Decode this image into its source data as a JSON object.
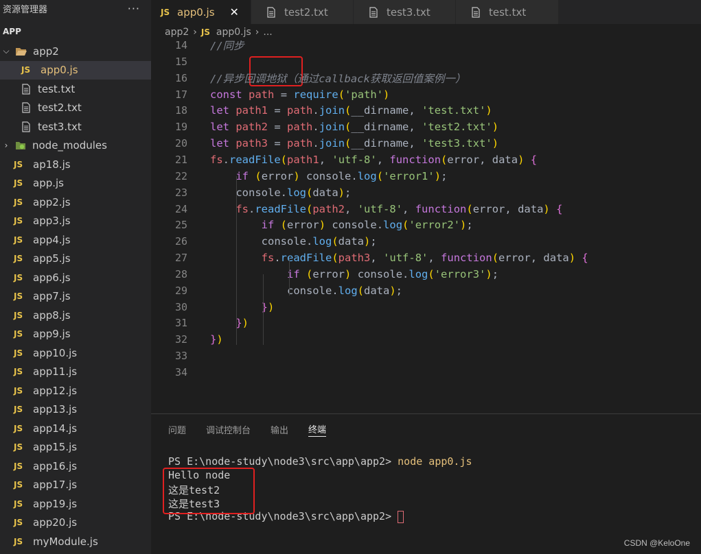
{
  "sidebar": {
    "title": "资源管理器",
    "more": "···",
    "section": "APP",
    "items": [
      {
        "label": "app2",
        "kind": "folder-open"
      },
      {
        "label": "app0.js",
        "kind": "js",
        "active": true
      },
      {
        "label": "test.txt",
        "kind": "txt"
      },
      {
        "label": "test2.txt",
        "kind": "txt"
      },
      {
        "label": "test3.txt",
        "kind": "txt"
      },
      {
        "label": "node_modules",
        "kind": "folder-closed"
      },
      {
        "label": "ap18.js",
        "kind": "js"
      },
      {
        "label": "app.js",
        "kind": "js"
      },
      {
        "label": "app2.js",
        "kind": "js"
      },
      {
        "label": "app3.js",
        "kind": "js"
      },
      {
        "label": "app4.js",
        "kind": "js"
      },
      {
        "label": "app5.js",
        "kind": "js"
      },
      {
        "label": "app6.js",
        "kind": "js"
      },
      {
        "label": "app7.js",
        "kind": "js"
      },
      {
        "label": "app8.js",
        "kind": "js"
      },
      {
        "label": "app9.js",
        "kind": "js"
      },
      {
        "label": "app10.js",
        "kind": "js"
      },
      {
        "label": "app11.js",
        "kind": "js"
      },
      {
        "label": "app12.js",
        "kind": "js"
      },
      {
        "label": "app13.js",
        "kind": "js"
      },
      {
        "label": "app14.js",
        "kind": "js"
      },
      {
        "label": "app15.js",
        "kind": "js"
      },
      {
        "label": "app16.js",
        "kind": "js"
      },
      {
        "label": "app17.js",
        "kind": "js"
      },
      {
        "label": "app19.js",
        "kind": "js"
      },
      {
        "label": "app20.js",
        "kind": "js"
      },
      {
        "label": "myModule.js",
        "kind": "js"
      }
    ]
  },
  "icons": {
    "js": "JS",
    "close": "✕"
  },
  "tabs": [
    {
      "label": "app0.js",
      "kind": "js",
      "active": true
    },
    {
      "label": "test2.txt",
      "kind": "txt"
    },
    {
      "label": "test3.txt",
      "kind": "txt"
    },
    {
      "label": "test.txt",
      "kind": "txt"
    }
  ],
  "breadcrumb": {
    "folder": "app2",
    "file": "app0.js",
    "more": "..."
  },
  "editor": {
    "lines": [
      {
        "n": "14",
        "text": "//同步"
      },
      {
        "n": "15",
        "text": ""
      },
      {
        "n": "16",
        "text": "//异步回调地狱（通过callback获取返回值案例一）"
      },
      {
        "n": "17",
        "text": "const path = require('path')"
      },
      {
        "n": "18",
        "text": "let path1 = path.join(__dirname, 'test.txt')"
      },
      {
        "n": "19",
        "text": "let path2 = path.join(__dirname, 'test2.txt')"
      },
      {
        "n": "20",
        "text": "let path3 = path.join(__dirname, 'test3.txt')"
      },
      {
        "n": "21",
        "text": "fs.readFile(path1, 'utf-8', function(error, data) {"
      },
      {
        "n": "22",
        "text": "    if (error) console.log('error1');"
      },
      {
        "n": "23",
        "text": "    console.log(data);"
      },
      {
        "n": "24",
        "text": "    fs.readFile(path2, 'utf-8', function(error, data) {"
      },
      {
        "n": "25",
        "text": "        if (error) console.log('error2');"
      },
      {
        "n": "26",
        "text": "        console.log(data);"
      },
      {
        "n": "27",
        "text": "        fs.readFile(path3, 'utf-8', function(error, data) {"
      },
      {
        "n": "28",
        "text": "            if (error) console.log('error3');"
      },
      {
        "n": "29",
        "text": "            console.log(data);"
      },
      {
        "n": "30",
        "text": "        })"
      },
      {
        "n": "31",
        "text": "    })"
      },
      {
        "n": "32",
        "text": "})"
      },
      {
        "n": "33",
        "text": ""
      },
      {
        "n": "34",
        "text": ""
      }
    ]
  },
  "panel": {
    "tabs": [
      "问题",
      "调试控制台",
      "输出",
      "终端"
    ],
    "active_tab": "终端",
    "terminal": {
      "prompt": "PS E:\\node-study\\node3\\src\\app\\app2> ",
      "command": "node app0.js",
      "output": [
        "Hello node",
        "这是test2",
        "这是test3"
      ],
      "prompt2": "PS E:\\node-study\\node3\\src\\app\\app2> "
    }
  },
  "watermark": "CSDN @KeloOne",
  "colors": {
    "accent": "#e5c07b",
    "annotation": "#e02020",
    "js_icon": "#e8c34b"
  }
}
